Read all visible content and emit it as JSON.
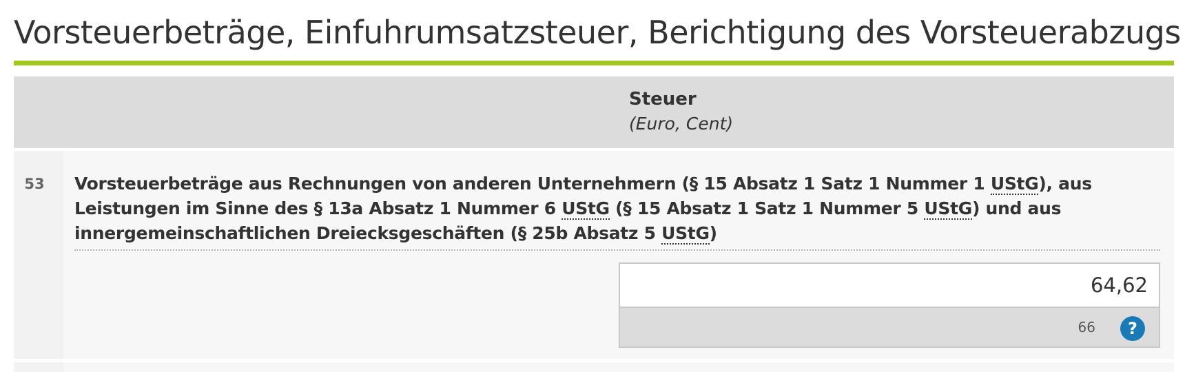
{
  "section": {
    "title": "Vorsteuerbeträge, Einfuhrumsatzsteuer, Berichtigung des Vorsteuerabzugs"
  },
  "columns": {
    "header": "Steuer",
    "subheader": "(Euro, Cent)"
  },
  "row": {
    "number": "53",
    "description_parts": [
      "Vorsteuerbeträge aus Rechnungen von anderen Unternehmern (§ 15 Absatz 1 Satz 1 Nummer 1 ",
      "UStG",
      "), aus Leistungen im Sinne des § 13a Absatz 1 Nummer 6 ",
      "UStG",
      " (§ 15 Absatz 1 Satz 1 Nummer 5 ",
      "UStG",
      ") und aus innergemeinschaftlichen Dreiecksgeschäften (§ 25b Absatz 5 ",
      "UStG",
      ")"
    ],
    "amount": "64,62",
    "field_code": "66",
    "help_icon": "question-icon",
    "help_label": "?"
  },
  "colors": {
    "accent_rule": "#a0c81e",
    "help_button": "#1a7ab8",
    "header_bg": "#dcdcdc"
  }
}
